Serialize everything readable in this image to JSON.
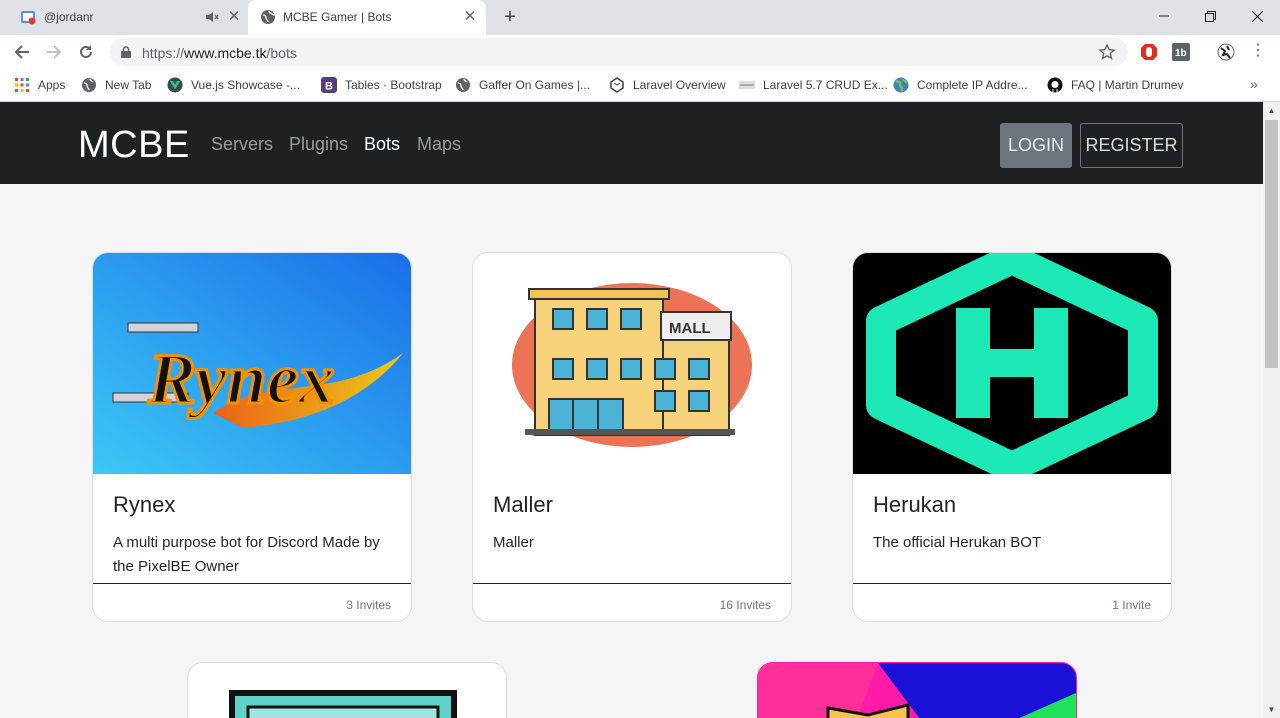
{
  "browser": {
    "tabs": [
      {
        "title": "@jordanr",
        "icon": "youtube-live-icon"
      },
      {
        "title": "MCBE Gamer | Bots",
        "icon": "globe-icon"
      }
    ],
    "address": {
      "scheme": "https://",
      "host": "www.mcbe.tk",
      "path": "/bots"
    },
    "bookmarks": [
      {
        "label": "Apps",
        "icon": "apps-grid-icon"
      },
      {
        "label": "New Tab",
        "icon": "globe-icon"
      },
      {
        "label": "Vue.js Showcase -...",
        "icon": "vue-icon"
      },
      {
        "label": "Tables · Bootstrap",
        "icon": "bootstrap-icon"
      },
      {
        "label": "Gaffer On Games |...",
        "icon": "globe-icon"
      },
      {
        "label": "Laravel Overview",
        "icon": "laravel-icon"
      },
      {
        "label": "Laravel 5.7 CRUD Ex...",
        "icon": "site-icon"
      },
      {
        "label": "Complete IP Addre...",
        "icon": "earth-icon"
      },
      {
        "label": "FAQ | Martin Drumev",
        "icon": "github-icon"
      }
    ]
  },
  "site": {
    "brand": "MCBE",
    "nav": [
      {
        "label": "Servers",
        "active": false
      },
      {
        "label": "Plugins",
        "active": false
      },
      {
        "label": "Bots",
        "active": true
      },
      {
        "label": "Maps",
        "active": false
      }
    ],
    "login_label": "LOGIN",
    "register_label": "REGISTER"
  },
  "bots": [
    {
      "name": "Rynex",
      "description": "A multi purpose bot for Discord Made by the PixelBE Owner",
      "invites": "3 Invites",
      "image_text": "Rynex"
    },
    {
      "name": "Maller",
      "description": "Maller",
      "invites": "16 Invites",
      "image_text": "MALL"
    },
    {
      "name": "Herukan",
      "description": "The official Herukan BOT",
      "invites": "1 Invite"
    }
  ],
  "colors": {
    "navbar": "#1e2124",
    "accent_green": "#1de9b6",
    "page_bg": "#f5f5f5"
  }
}
